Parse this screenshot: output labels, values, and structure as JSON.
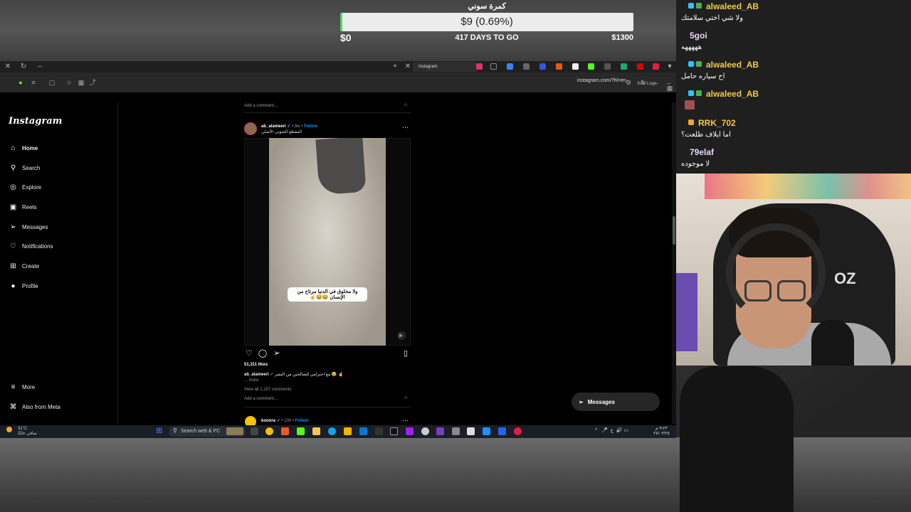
{
  "overlay": {
    "goal": {
      "title": "كمرة سوني",
      "amount": "$9 (0.69%)",
      "start": "$0",
      "days": "417 DAYS TO GO",
      "target": "$1300",
      "progress_percent": 0.69
    }
  },
  "browser": {
    "tab_title": "Instagram",
    "url": "instagram.com/?hl=en",
    "kick_logo": "Kick Logo"
  },
  "instagram": {
    "logo": "Instagram",
    "nav": [
      {
        "label": "Home"
      },
      {
        "label": "Search"
      },
      {
        "label": "Explore"
      },
      {
        "label": "Reels"
      },
      {
        "label": "Messages"
      },
      {
        "label": "Notifications"
      },
      {
        "label": "Create"
      },
      {
        "label": "Profile"
      }
    ],
    "bottom_nav": [
      {
        "label": "More"
      },
      {
        "label": "Also from Meta"
      }
    ],
    "feed": {
      "add_comment_top": "Add a comment...",
      "post": {
        "username": "ab_alameeri",
        "time": "• 8w •",
        "follow": "Follow",
        "audio": "المقطع الصوتي الأصلي",
        "overlay_text": "ولا مخلوق في الدنيا مرتاح من الإنسان 😂😂☝️",
        "likes": "51,311 likes",
        "caption_user": "ab_alameeri",
        "caption_text": "مع احترامي للصالحين من البشر 😂 ☝️",
        "more": "... more",
        "view_all": "View all 1,157 comments",
        "add_comment": "Add a comment..."
      },
      "next_post": {
        "username": "kooora",
        "time": "• 10h •",
        "follow": "Follow"
      }
    },
    "messages_button": "Messages"
  },
  "taskbar": {
    "weather_temp": "31°C",
    "weather_desc": "صافي غالبًا",
    "search_placeholder": "Search web & PC",
    "clock_time": "٩:٢٣ م",
    "clock_date": "٢٧/٠٣/٢٥"
  },
  "chat": {
    "messages": [
      {
        "user": "alwaleed_AB",
        "text": "ولا شي اختي سلامتك",
        "color": "#f2c94c"
      },
      {
        "user": "5goi",
        "text": "هههههه",
        "color": "#e6d6ff"
      },
      {
        "user": "alwaleed_AB",
        "text": "اح سياره حامل",
        "color": "#f2c94c"
      },
      {
        "user": "alwaleed_AB",
        "text": "",
        "color": "#f2c94c"
      },
      {
        "user": "RRK_702",
        "text": "اما ايلاف طلعت؟",
        "color": "#f2c94c"
      },
      {
        "user": "79elaf",
        "text": "لا موجوده",
        "color": "#e6d6ff"
      }
    ]
  },
  "icons": {
    "home": "home-icon",
    "search": "search-icon",
    "explore": "compass-icon",
    "reels": "reels-icon",
    "messages": "messenger-icon",
    "notifications": "heart-icon",
    "create": "plus-square-icon",
    "profile": "avatar-icon",
    "more": "hamburger-icon",
    "meta": "threads-icon"
  }
}
